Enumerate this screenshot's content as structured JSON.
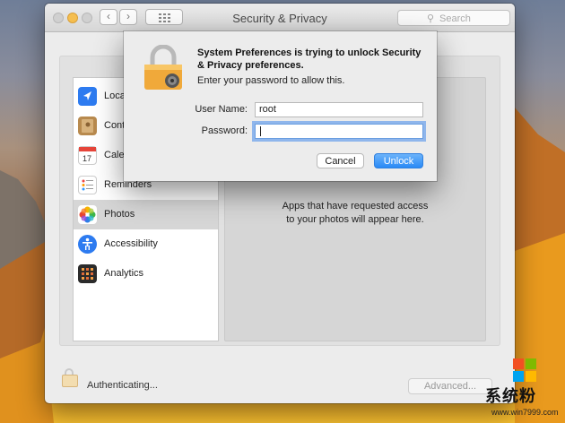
{
  "window": {
    "title": "Security & Privacy"
  },
  "search": {
    "placeholder": "Search"
  },
  "sidebar": {
    "items": [
      {
        "label": "Location Services"
      },
      {
        "label": "Contacts"
      },
      {
        "label": "Calendars"
      },
      {
        "label": "Reminders"
      },
      {
        "label": "Photos"
      },
      {
        "label": "Accessibility"
      },
      {
        "label": "Analytics"
      }
    ]
  },
  "panel": {
    "message_line1": "Apps that have requested access",
    "message_line2": "to your photos will appear here."
  },
  "footer": {
    "status": "Authenticating...",
    "advanced_label": "Advanced..."
  },
  "dialog": {
    "title": "System Preferences is trying to unlock Security & Privacy preferences.",
    "subtitle": "Enter your password to allow this.",
    "username_label": "User Name:",
    "username_value": "root",
    "password_label": "Password:",
    "cancel_label": "Cancel",
    "unlock_label": "Unlock"
  },
  "watermark": {
    "brand": "系统粉",
    "url": "www.win7999.com"
  },
  "colors": {
    "accent": "#2a8af6",
    "selection": "#d6d6d6"
  }
}
